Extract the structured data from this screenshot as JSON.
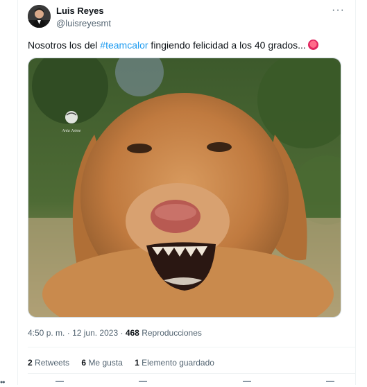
{
  "tweet": {
    "author_name": "Luis Reyes",
    "author_handle": "@luisreyesmt",
    "more_icon": "more-dots-icon",
    "text_before": "Nosotros los del ",
    "hashtag": "#teamcalor",
    "text_after": " fingiendo felicidad a los 40 grados...",
    "emoji_icon": "hot-face-emoji",
    "image_alt": "Golden retriever sonriendo",
    "image_watermark": "Anta Jaime",
    "time": "4:50 p. m.",
    "date": "12 jun. 2023",
    "dot_separator": "·",
    "views_count": "468",
    "views_label": "Reproducciones",
    "retweets_count": "2",
    "retweets_label": "Retweets",
    "likes_count": "6",
    "likes_label": "Me gusta",
    "bookmarks_count": "1",
    "bookmarks_label": "Elemento guardado"
  },
  "sidebar": {
    "more_dots": "••"
  },
  "colors": {
    "accent": "#1d9bf0",
    "secondary_text": "#536471",
    "border": "#eff3f4"
  }
}
